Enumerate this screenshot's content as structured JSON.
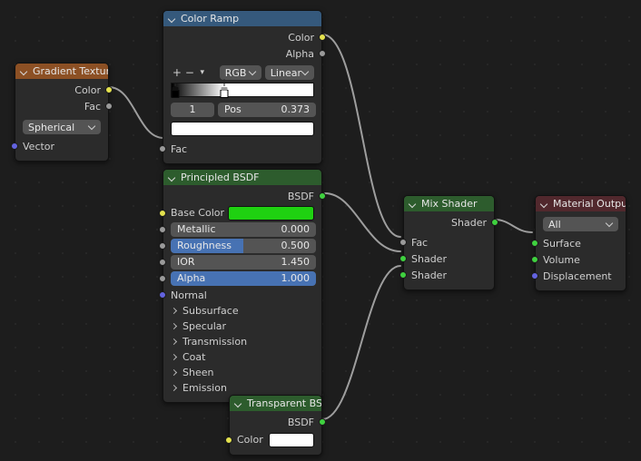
{
  "editor": {
    "name": "blender-shader-node-editor",
    "background_color": "#1d1d1d"
  },
  "nodes": [
    {
      "id": "gradient-texture",
      "title": "Gradient Texture",
      "header_color": "#8c5024",
      "outputs": [
        {
          "label": "Color",
          "socket_color": "#e4e24e"
        },
        {
          "label": "Fac",
          "socket_color": "#9a9a9a"
        }
      ],
      "dropdown": {
        "label": "Spherical"
      },
      "inputs": [
        {
          "label": "Vector",
          "socket_color": "#6363e0"
        }
      ]
    },
    {
      "id": "color-ramp",
      "title": "Color Ramp",
      "header_color": "#35597c",
      "outputs": [
        {
          "label": "Color",
          "socket_color": "#e4e24e"
        },
        {
          "label": "Alpha",
          "socket_color": "#9a9a9a"
        }
      ],
      "tools": [
        "+",
        "−",
        "⌄"
      ],
      "color_mode": "RGB",
      "interpolation": "Linear",
      "ramp_stops": [
        {
          "position": 0.0,
          "color": "#000000"
        },
        {
          "position": 0.373,
          "color": "#ffffff"
        }
      ],
      "active_index": "1",
      "pos_label": "Pos",
      "pos_value": "0.373",
      "active_color": "#ffffff",
      "inputs": [
        {
          "label": "Fac",
          "socket_color": "#9a9a9a"
        }
      ]
    },
    {
      "id": "principled-bsdf",
      "title": "Principled BSDF",
      "header_color": "#2d5c2d",
      "outputs": [
        {
          "label": "BSDF",
          "socket_color": "#3fd13f"
        }
      ],
      "base_color": {
        "label": "Base Color",
        "socket_color": "#e4e24e",
        "value": "#1fd111"
      },
      "sliders": [
        {
          "label": "Metallic",
          "value": "0.000",
          "fraction": 0.0,
          "socket_color": "#9a9a9a"
        },
        {
          "label": "Roughness",
          "value": "0.500",
          "fraction": 0.5,
          "socket_color": "#9a9a9a"
        },
        {
          "label": "IOR",
          "value": "1.450",
          "fraction": 0.0,
          "socket_color": "#9a9a9a"
        },
        {
          "label": "Alpha",
          "value": "1.000",
          "fraction": 1.0,
          "socket_color": "#9a9a9a"
        }
      ],
      "normal": {
        "label": "Normal",
        "socket_color": "#6363e0"
      },
      "panels": [
        "Subsurface",
        "Specular",
        "Transmission",
        "Coat",
        "Sheen",
        "Emission"
      ]
    },
    {
      "id": "mix-shader",
      "title": "Mix Shader",
      "header_color": "#2d5c2d",
      "outputs": [
        {
          "label": "Shader",
          "socket_color": "#3fd13f"
        }
      ],
      "inputs": [
        {
          "label": "Fac",
          "socket_color": "#9a9a9a"
        },
        {
          "label": "Shader",
          "socket_color": "#3fd13f"
        },
        {
          "label": "Shader",
          "socket_color": "#3fd13f"
        }
      ]
    },
    {
      "id": "material-output",
      "title": "Material Output",
      "header_color": "#51282d",
      "dropdown": {
        "label": "All"
      },
      "inputs": [
        {
          "label": "Surface",
          "socket_color": "#3fd13f"
        },
        {
          "label": "Volume",
          "socket_color": "#3fd13f"
        },
        {
          "label": "Displacement",
          "socket_color": "#6363e0"
        }
      ]
    },
    {
      "id": "transparent-bsdf",
      "title": "Transparent BSDF",
      "header_color": "#2d5c2d",
      "outputs": [
        {
          "label": "BSDF",
          "socket_color": "#3fd13f"
        }
      ],
      "color_input": {
        "label": "Color",
        "socket_color": "#e4e24e",
        "value": "#ffffff"
      }
    }
  ],
  "links": [
    {
      "from": "gradient-texture.Color",
      "to": "color-ramp.Fac"
    },
    {
      "from": "color-ramp.Color",
      "to": "mix-shader.Fac"
    },
    {
      "from": "principled-bsdf.BSDF",
      "to": "mix-shader.Shader1"
    },
    {
      "from": "transparent-bsdf.BSDF",
      "to": "mix-shader.Shader2"
    },
    {
      "from": "mix-shader.Shader",
      "to": "material-output.Surface"
    }
  ]
}
